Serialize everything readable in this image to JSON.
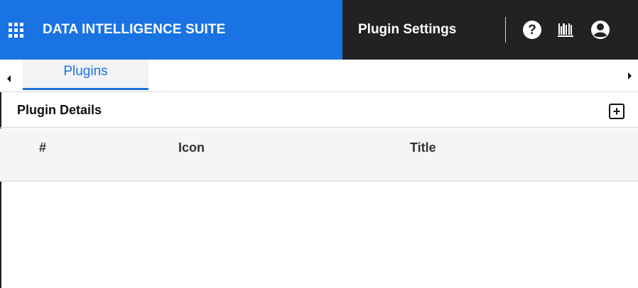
{
  "header": {
    "apps_icon": "apps-grid-icon",
    "brand_title": "DATA INTELLIGENCE SUITE",
    "page_title": "Plugin Settings",
    "icons": [
      "help-icon",
      "library-icon",
      "user-account-icon"
    ],
    "colors": {
      "brand": "#1a73e2",
      "dark": "#222222"
    }
  },
  "tabs": [
    {
      "label": "Plugins",
      "active": true
    }
  ],
  "section": {
    "title": "Plugin Details",
    "add_icon": "add-box-icon"
  },
  "table": {
    "columns": [
      "#",
      "Icon",
      "Title"
    ],
    "rows": []
  }
}
